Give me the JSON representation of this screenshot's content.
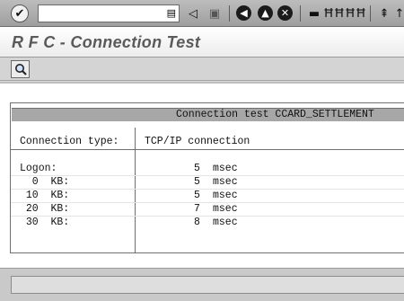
{
  "toolbar": {
    "command_field_value": "",
    "icons": [
      "ok-icon",
      "save-icon",
      "back-icon",
      "exit-icon",
      "cancel-icon",
      "print-icon",
      "find-icon",
      "find-next-icon",
      "first-page-icon"
    ]
  },
  "title": "R F C - Connection Test",
  "app_toolbar": {
    "icon": "test-icon"
  },
  "results": {
    "header": "Connection test CCARD_SETTLEMENT",
    "connection_type_label": "Connection type:",
    "connection_type_value": "TCP/IP connection",
    "rows": [
      {
        "label": "Logon:",
        "value": "5",
        "unit": "msec"
      },
      {
        "label": "  0  KB:",
        "value": "5",
        "unit": "msec"
      },
      {
        "label": " 10  KB:",
        "value": "5",
        "unit": "msec"
      },
      {
        "label": " 20  KB:",
        "value": "7",
        "unit": "msec"
      },
      {
        "label": " 30  KB:",
        "value": "8",
        "unit": "msec"
      }
    ]
  },
  "status_text": ""
}
